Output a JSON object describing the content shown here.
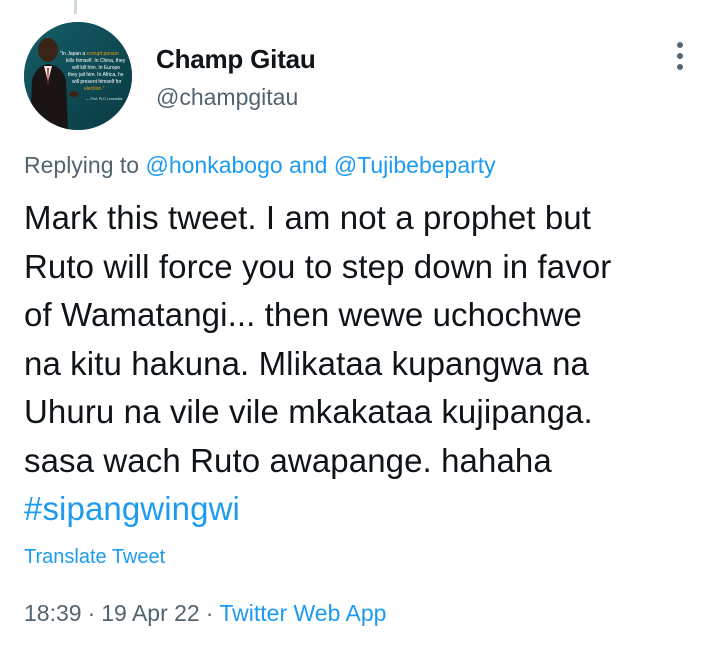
{
  "author": {
    "display_name": "Champ Gitau",
    "handle": "@champgitau"
  },
  "reply": {
    "prefix": "Replying to",
    "mention_1": "@honkabogo",
    "joiner": "and",
    "mention_2": "@Tujibebeparty"
  },
  "tweet": {
    "lines": [
      "Mark this tweet. I am not a prophet but",
      "Ruto will force you to step down in favor",
      "of Wamatangi... then wewe uchochwe",
      "na kitu hakuna. Mlikataa kupangwa na",
      "Uhuru na vile vile mkakataa kujipanga.",
      "sasa wach Ruto awapange. hahaha"
    ],
    "hashtag": "#sipangwingwi"
  },
  "translate_label": "Translate Tweet",
  "meta": {
    "time": "18:39",
    "date": "19 Apr 22",
    "separator": "·",
    "source": "Twitter Web App"
  },
  "avatar_text": {
    "l1a": "\"In Japan a ",
    "l1b": "corrupt person",
    "l2": "kills himself. In China, they",
    "l3": "will kill him. In Europe",
    "l4": "they jail him. In Africa, he",
    "l5": "will present himself for",
    "l6": "election.\"",
    "credit": "— Prof. PLO Lumumba"
  },
  "colors": {
    "link": "#1d9bf0",
    "secondary_text": "#536471",
    "primary_text": "#0f1419",
    "avatar_bg": "#0e4a52"
  },
  "icons": {
    "more": "vertical-ellipsis-icon"
  }
}
